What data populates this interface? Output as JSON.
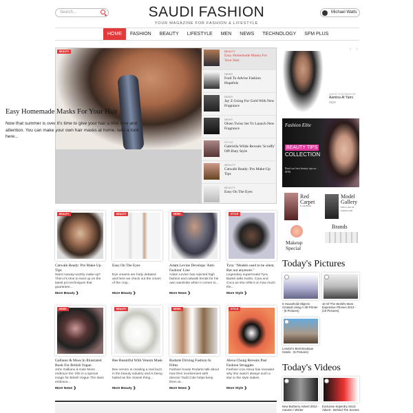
{
  "header": {
    "search_placeholder": "Search...",
    "logo": "SAUDI FASHION",
    "tagline": "YOUR MAGAZINE FOR FASHION & LIFESTYLE",
    "user_name": "Michael Watts"
  },
  "nav": [
    "HOME",
    "FASHION",
    "BEAUTY",
    "LIFESTYLE",
    "MEN",
    "NEWS",
    "TECHNOLOGY",
    "SFM PLUS"
  ],
  "hero": {
    "badge": "BEAUTY",
    "title": "Easy Homemade Masks For Your Hair",
    "text": "Now that summer is over it's time to give your hair a little love and attention. You can make your own hair masks at home, take a look here..."
  },
  "hero_side": [
    {
      "cat": "BEAUTY",
      "title": "Easy Homemade Masks For Your Hair"
    },
    {
      "cat": "NEWS",
      "title": "Ford To Advise Fashion Hopefuls"
    },
    {
      "cat": "NEWS",
      "title": "Jay Z Going For Gold With New Fragrance"
    },
    {
      "cat": "NEWS",
      "title": "Olsen Twins Set To Launch New Fragrance"
    },
    {
      "cat": "STYLE",
      "title": "Gabriella Wilde Reveals 'Scruffy' Off-Duty Style"
    },
    {
      "cat": "BEAUTY",
      "title": "Catwalk Ready: Pro Make-Up Tips"
    },
    {
      "cat": "BEAUTY",
      "title": "Easy On The Eyes"
    }
  ],
  "cards_row1": [
    {
      "badge": "BEAUTY",
      "title": "Catwalk Ready: Pro Make-Up Tips",
      "desc": "Want runway-worthy make-up? Then it's time to swot up on the latest pro techniques that guarantee...",
      "more": "More Beauty ❯"
    },
    {
      "badge": "BEAUTY",
      "title": "Easy On The Eyes",
      "desc": "Eye creams are hotly debated and here we check out the cream of the crop.",
      "more": "More Beauty ❯"
    },
    {
      "badge": "NEWS",
      "title": "Adam Levine Develops 'Anti-Fashion' Line",
      "desc": "Adam Levine has rejected high fashion and catwalk trends for his own wardrobe when it comes to...",
      "more": "More News ❯"
    },
    {
      "badge": "STYLE",
      "title": "Tyra: \"Models used to be silent. But not anymore.\"",
      "desc": "Legendary supermodel Tyra Banks talks Karlie, Cara and Coco as she reflect on how much the...",
      "more": "More Style ❯"
    }
  ],
  "cards_row2": [
    {
      "badge": "NEWS",
      "title": "Galliano & Moss In Illustrated Book For British Vogue",
      "desc": "John Galliano & Kate Moss embrace the '20s in a special image for British Vogue The stars embrace...",
      "more": "More News ❯"
    },
    {
      "badge": "BEAUTY",
      "title": "Bee Beautiful With Venom Mask",
      "desc": "Bee venom is creating a real buzz in the beauty industry and is being hailed as the closest thing...",
      "more": "More Beauty ❯"
    },
    {
      "badge": "NEWS",
      "title": "Rodarte Driving Fashion In Films",
      "desc": "Fashion house Rodarte talk about how their involvement with director Todd Cole helps keep them at...",
      "more": "More News ❯"
    },
    {
      "badge": "STYLE",
      "title": "Alexa Chung Reveals Past Fashion Struggles",
      "desc": "Fashion icon Alexa has revealed why she wasn't always such a star in the style stakes.",
      "more": "More Style ❯"
    }
  ],
  "guest": {
    "label": "GUEST CONTRIBUTOR",
    "name": "Aamina Al Yami",
    "style": "Style",
    "arrows": "‹ ›"
  },
  "ad_beauty": {
    "brand": "Fashion Elite",
    "headline": "BEAUTY TIPS",
    "collection": "COLLECTION",
    "read": "Read our best beauty tips on SFM"
  },
  "ad_links": {
    "red_carpet": "Red Carpet",
    "look_book": "Look Book",
    "model_gallery": "Model Gallery",
    "whos_who": "Who's who in fashion land",
    "brands": "Brands",
    "makeup": "Makeup Special"
  },
  "todays_pictures": {
    "title": "Today's Pictures",
    "items": [
      {
        "caption": "5 Household Objects Created Using A 3D Printer - (5 Pictures)"
      },
      {
        "caption": "10 Of The World's Most Expensive Phones 2013 - (10 Pictures)"
      },
      {
        "caption": "London's Best Boutique Hotels - (5 Pictures)"
      }
    ]
  },
  "todays_videos": {
    "title": "Today's Videos",
    "items": [
      {
        "caption": "New Burberry Advert 2013 - Autumn / Winter"
      },
      {
        "caption": "Exclusive Superdry SS13 Advert - Behind The Scenes"
      }
    ]
  }
}
